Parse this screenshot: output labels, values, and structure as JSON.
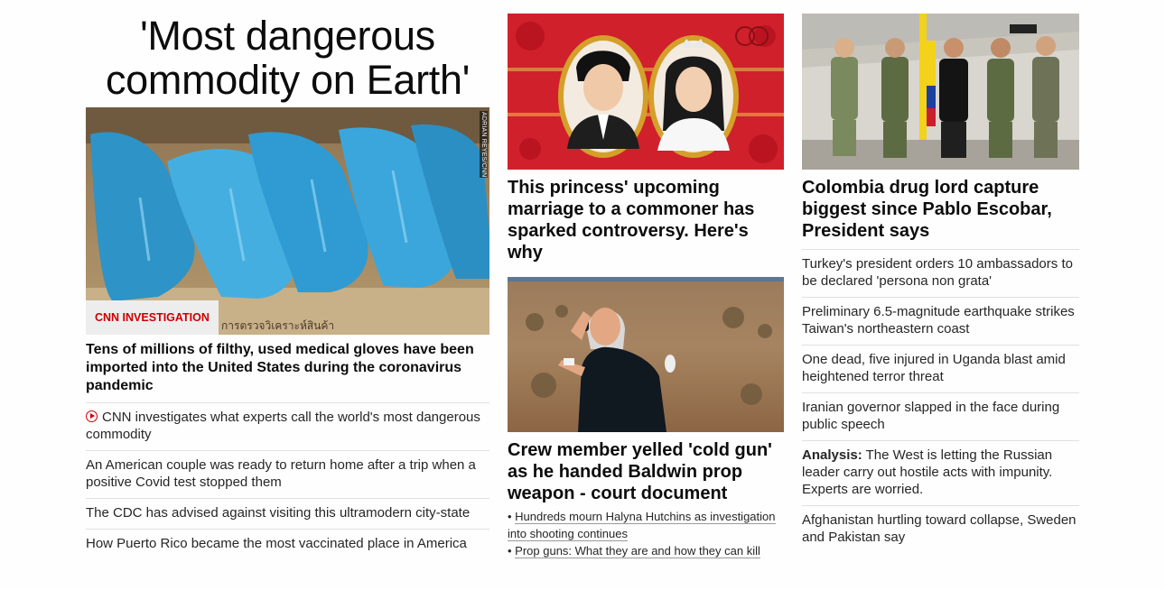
{
  "col1": {
    "headline": "'Most dangerous commodity on Earth'",
    "image_credit": "ADRIAN REYES/CNN",
    "image_text": "การตรวจวิเคราะห์สินค้า",
    "badge": "CNN INVESTIGATION",
    "lead": "Tens of millions of filthy, used medical gloves have been imported into the United States during the coronavirus pandemic",
    "items": [
      "CNN investigates what experts call the world's most dangerous commodity",
      "An American couple was ready to return home after a trip when a positive Covid test stopped them",
      "The CDC has advised against visiting this ultramodern city-state",
      "How Puerto Rico became the most vaccinated place in America"
    ]
  },
  "col2": {
    "story1_lead": "This princess' upcoming marriage to a commoner has sparked controversy. Here's why",
    "story2_lead": "Crew member yelled 'cold gun' as he handed Baldwin prop weapon - court document",
    "story2_links": [
      "Hundreds mourn Halyna Hutchins as investigation into shooting continues",
      "Prop guns: What they are and how they can kill"
    ]
  },
  "col3": {
    "lead": "Colombia drug lord capture biggest since Pablo Escobar, President says",
    "items": [
      "Turkey's president orders 10 ambassadors to be declared 'persona non grata'",
      "Preliminary 6.5-magnitude earthquake strikes Taiwan's northeastern coast",
      "One dead, five injured in Uganda blast amid heightened terror threat",
      "Iranian governor slapped in the face during public speech"
    ],
    "analysis_label": "Analysis:",
    "analysis_text": " The West is letting the Russian leader carry out hostile acts with impunity. Experts are worried.",
    "last_item": "Afghanistan hurtling toward collapse, Sweden and Pakistan say"
  },
  "colors": {
    "accent": "#cc0000",
    "text": "#0c0c0c",
    "divider": "#e0e0e0",
    "princess_bg": "#d0202c"
  },
  "icons": [
    "play-icon"
  ]
}
